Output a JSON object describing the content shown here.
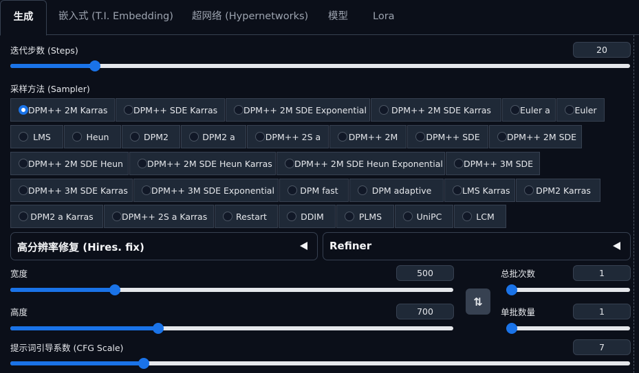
{
  "tabs": [
    {
      "label": "生成",
      "active": true
    },
    {
      "label": "嵌入式 (T.I. Embedding)",
      "active": false
    },
    {
      "label": "超网络 (Hypernetworks)",
      "active": false
    },
    {
      "label": "模型",
      "active": false
    },
    {
      "label": "Lora",
      "active": false
    }
  ],
  "steps": {
    "label": "迭代步数 (Steps)",
    "value": "20",
    "fraction": 0.13
  },
  "sampler": {
    "label": "采样方法 (Sampler)",
    "selected": "DPM++ 2M Karras",
    "rows": [
      [
        "DPM++ 2M Karras",
        "DPM++ SDE Karras",
        "DPM++ 2M SDE Exponential",
        "DPM++ 2M SDE Karras",
        "Euler a",
        "Euler"
      ],
      [
        "LMS",
        "Heun",
        "DPM2",
        "DPM2 a",
        "DPM++ 2S a",
        "DPM++ 2M",
        "DPM++ SDE",
        "DPM++ 2M SDE"
      ],
      [
        "DPM++ 2M SDE Heun",
        "DPM++ 2M SDE Heun Karras",
        "DPM++ 2M SDE Heun Exponential",
        "DPM++ 3M SDE"
      ],
      [
        "DPM++ 3M SDE Karras",
        "DPM++ 3M SDE Exponential",
        "DPM fast",
        "DPM adaptive",
        "LMS Karras",
        "DPM2 Karras"
      ],
      [
        "DPM2 a Karras",
        "DPM++ 2S a Karras",
        "Restart",
        "DDIM",
        "PLMS",
        "UniPC",
        "LCM"
      ]
    ]
  },
  "hires": {
    "label": "高分辨率修复 (Hires. fix)",
    "icon": "collapse-left-icon"
  },
  "refiner": {
    "label": "Refiner",
    "icon": "collapse-left-icon"
  },
  "width": {
    "label": "宽度",
    "value": "500",
    "fraction": 0.23
  },
  "height": {
    "label": "高度",
    "value": "700",
    "fraction": 0.33
  },
  "swap": {
    "icon": "swap-dimensions-icon",
    "glyph": "⇅"
  },
  "batch_count": {
    "label": "总批次数",
    "value": "1",
    "fraction": 0.0
  },
  "batch_size": {
    "label": "单批数量",
    "value": "1",
    "fraction": 0.0
  },
  "cfg": {
    "label": "提示词引导系数 (CFG Scale)",
    "value": "7",
    "fraction": 0.21
  },
  "colors": {
    "accent": "#1a73e8",
    "background": "#0b0f19",
    "panel": "#1f2937",
    "border": "#374151"
  }
}
